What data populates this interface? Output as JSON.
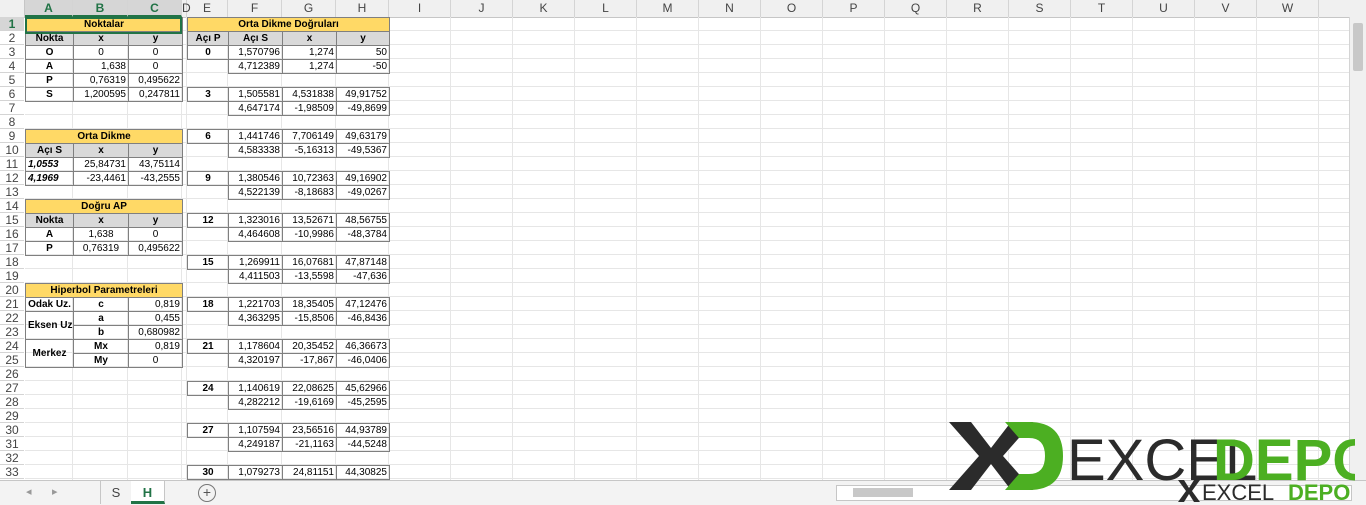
{
  "columns": [
    "A",
    "B",
    "C",
    "D",
    "E",
    "F",
    "G",
    "H",
    "I",
    "J",
    "K",
    "L",
    "M",
    "N",
    "O",
    "P",
    "Q",
    "R",
    "S",
    "T",
    "U",
    "V",
    "W"
  ],
  "rows": [
    "1",
    "2",
    "3",
    "4",
    "5",
    "6",
    "7",
    "8",
    "9",
    "10",
    "11",
    "12",
    "13",
    "14",
    "15",
    "16",
    "17",
    "18",
    "19",
    "20",
    "21",
    "22",
    "23",
    "24",
    "25",
    "26",
    "27",
    "28",
    "29",
    "30",
    "31",
    "32",
    "33"
  ],
  "noktalar": {
    "title": "Noktalar",
    "headers": [
      "Nokta",
      "x",
      "y"
    ],
    "rows": [
      [
        "O",
        "0",
        "0"
      ],
      [
        "A",
        "1,638",
        "0"
      ],
      [
        "P",
        "0,76319",
        "0,495622"
      ],
      [
        "S",
        "1,200595",
        "0,247811"
      ]
    ]
  },
  "orta_dikme": {
    "title": "Orta Dikme",
    "headers": [
      "Açı S",
      "x",
      "y"
    ],
    "rows": [
      [
        "1,0553",
        "25,84731",
        "43,75114"
      ],
      [
        "4,1969",
        "-23,4461",
        "-43,2555"
      ]
    ]
  },
  "dogru_ap": {
    "title": "Doğru AP",
    "headers": [
      "Nokta",
      "x",
      "y"
    ],
    "rows": [
      [
        "A",
        "1,638",
        "0"
      ],
      [
        "P",
        "0,76319",
        "0,495622"
      ]
    ]
  },
  "hiperbol": {
    "title": "Hiperbol Parametreleri",
    "odak_label": "Odak Uz.",
    "eksen_label": "Eksen Uz.",
    "merkez_label": "Merkez",
    "rows": [
      [
        "c",
        "0,819"
      ],
      [
        "a",
        "0,455"
      ],
      [
        "b",
        "0,680982"
      ],
      [
        "Mx",
        "0,819"
      ],
      [
        "My",
        "0"
      ]
    ]
  },
  "orta_dikme_dogrulari": {
    "title": "Orta Dikme Doğruları",
    "headers": [
      "Açı P",
      "Açı S",
      "x",
      "y"
    ],
    "groups": [
      {
        "aci_p": "0",
        "r1": [
          "1,570796",
          "1,274",
          "50"
        ],
        "r2": [
          "4,712389",
          "1,274",
          "-50"
        ]
      },
      {
        "aci_p": "3",
        "r1": [
          "1,505581",
          "4,531838",
          "49,91752"
        ],
        "r2": [
          "4,647174",
          "-1,98509",
          "-49,8699"
        ]
      },
      {
        "aci_p": "6",
        "r1": [
          "1,441746",
          "7,706149",
          "49,63179"
        ],
        "r2": [
          "4,583338",
          "-5,16313",
          "-49,5367"
        ]
      },
      {
        "aci_p": "9",
        "r1": [
          "1,380546",
          "10,72363",
          "49,16902"
        ],
        "r2": [
          "4,522139",
          "-8,18683",
          "-49,0267"
        ]
      },
      {
        "aci_p": "12",
        "r1": [
          "1,323016",
          "13,52671",
          "48,56755"
        ],
        "r2": [
          "4,464608",
          "-10,9986",
          "-48,3784"
        ]
      },
      {
        "aci_p": "15",
        "r1": [
          "1,269911",
          "16,07681",
          "47,87148"
        ],
        "r2": [
          "4,411503",
          "-13,5598",
          "-47,636"
        ]
      },
      {
        "aci_p": "18",
        "r1": [
          "1,221703",
          "18,35405",
          "47,12476"
        ],
        "r2": [
          "4,363295",
          "-15,8506",
          "-46,8436"
        ]
      },
      {
        "aci_p": "21",
        "r1": [
          "1,178604",
          "20,35452",
          "46,36673"
        ],
        "r2": [
          "4,320197",
          "-17,867",
          "-46,0406"
        ]
      },
      {
        "aci_p": "24",
        "r1": [
          "1,140619",
          "22,08625",
          "45,62966"
        ],
        "r2": [
          "4,282212",
          "-19,6169",
          "-45,2595"
        ]
      },
      {
        "aci_p": "27",
        "r1": [
          "1,107594",
          "23,56516",
          "44,93789"
        ],
        "r2": [
          "4,249187",
          "-21,1163",
          "-44,5248"
        ]
      },
      {
        "aci_p": "30",
        "r1": [
          "1,079273",
          "24,81151",
          "44,30825"
        ],
        "r2": null
      }
    ]
  },
  "sheet_tabs": [
    "S",
    "H"
  ],
  "active_tab": "H",
  "logo_text": {
    "part1": "EXCEL",
    "part2": "DEPO"
  },
  "colors": {
    "accent": "#217346",
    "title_fill": "#ffd966",
    "header_fill": "#d9d9d9",
    "logo_green": "#4caf22",
    "logo_dark": "#2b2b2b"
  }
}
